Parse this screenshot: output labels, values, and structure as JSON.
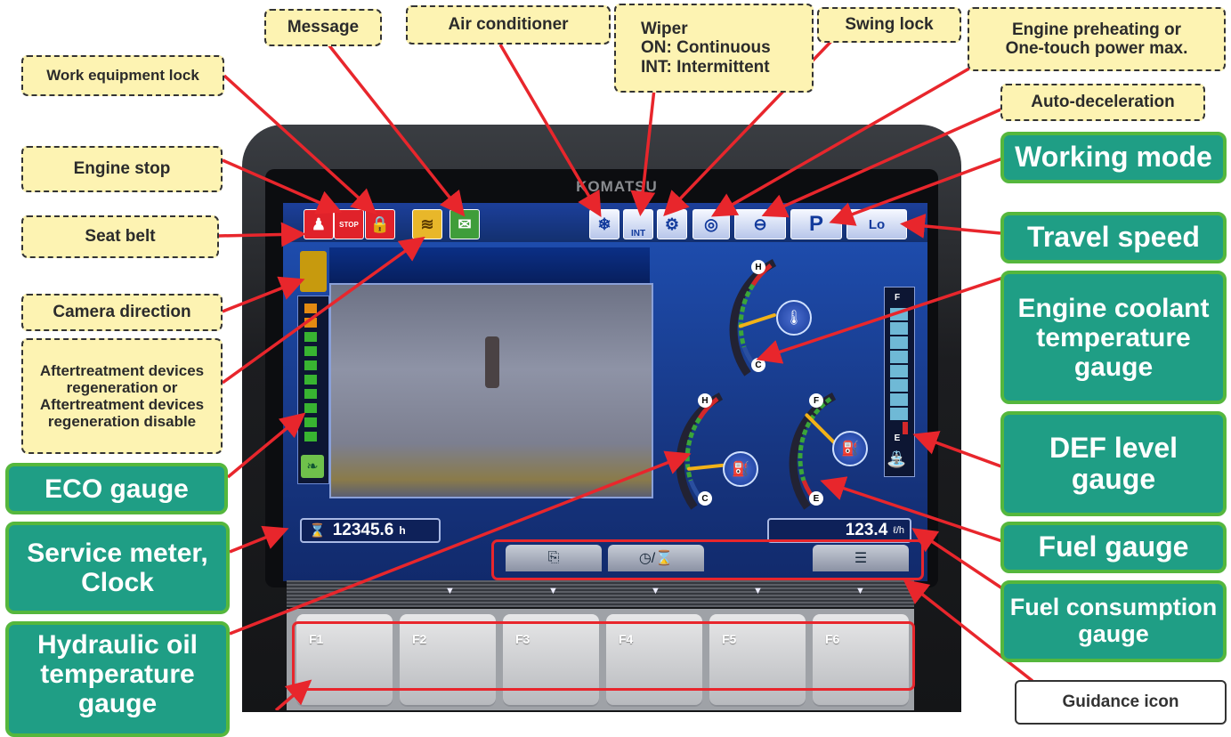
{
  "brand": "KOMATSU",
  "callouts": {
    "message": "Message",
    "air_conditioner": "Air conditioner",
    "wiper": [
      "Wiper",
      "ON: Continuous",
      "INT: Intermittent"
    ],
    "swing_lock": "Swing lock",
    "engine_preheat": [
      "Engine preheating or",
      "One-touch power max."
    ],
    "auto_decel": "Auto-deceleration",
    "work_equipment_lock": "Work equipment lock",
    "engine_stop": "Engine stop",
    "seat_belt": "Seat belt",
    "camera_direction": "Camera direction",
    "aftertreatment": [
      "Aftertreatment devices",
      "regeneration or",
      "Aftertreatment devices",
      "regeneration disable"
    ],
    "eco_gauge": "ECO gauge",
    "service_meter": [
      "Service meter,",
      "Clock"
    ],
    "hydraulic_oil": [
      "Hydraulic oil",
      "temperature",
      "gauge"
    ],
    "working_mode": "Working mode",
    "travel_speed": "Travel speed",
    "coolant": [
      "Engine coolant",
      "temperature",
      "gauge"
    ],
    "def_level": [
      "DEF level",
      "gauge"
    ],
    "fuel_gauge": "Fuel gauge",
    "fuel_consumption": [
      "Fuel consumption",
      "gauge"
    ],
    "guidance_icon": "Guidance icon"
  },
  "screen": {
    "service_meter_value": "12345.6",
    "service_meter_unit": "h",
    "fuel_rate_value": "123.4",
    "fuel_rate_unit": "ℓ/h",
    "working_mode_letter": "P",
    "travel_speed_label": "Lo",
    "wiper_label": "INT",
    "stop_label": "STOP",
    "gauge_high": "H",
    "gauge_cold": "C",
    "gauge_full": "F",
    "gauge_empty": "E"
  },
  "function_keys": [
    "F1",
    "F2",
    "F3",
    "F4",
    "F5",
    "F6"
  ],
  "colors": {
    "callout_yellow": "#fdf3b2",
    "callout_green": "#1f9e85",
    "arrow_red": "#e8262c",
    "screen_blue": "#1f50b4"
  }
}
